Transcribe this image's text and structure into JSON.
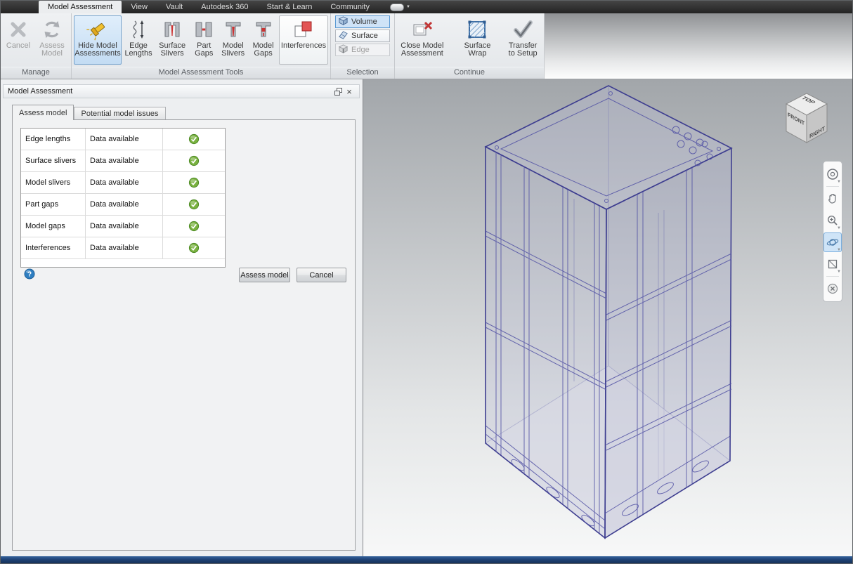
{
  "menubar": {
    "tabs": [
      "Model Assessment",
      "View",
      "Vault",
      "Autodesk 360",
      "Start & Learn",
      "Community"
    ]
  },
  "glyphs": {
    "caret": "▼",
    "close": "×",
    "help": "?"
  },
  "ribbon": {
    "groups": {
      "manage": {
        "label": "Manage",
        "cancel": "Cancel",
        "assess_model": "Assess Model"
      },
      "tools": {
        "label": "Model Assessment Tools",
        "hide_model_assessments": "Hide Model Assessments",
        "edge_lengths": "Edge Lengths",
        "surface_slivers": "Surface Slivers",
        "part_gaps": "Part Gaps",
        "model_slivers": "Model Slivers",
        "model_gaps": "Model Gaps",
        "interferences": "Interferences"
      },
      "selection": {
        "label": "Selection",
        "volume": "Volume",
        "surface": "Surface",
        "edge": "Edge"
      },
      "continue": {
        "label": "Continue",
        "close_model_assessment": "Close Model Assessment",
        "surface_wrap": "Surface Wrap",
        "transfer_to_setup": "Transfer to Setup"
      }
    }
  },
  "panel": {
    "title": "Model Assessment",
    "tabs": [
      "Assess model",
      "Potential model issues"
    ],
    "rows": [
      {
        "name": "Edge lengths",
        "status": "Data available"
      },
      {
        "name": "Surface slivers",
        "status": "Data available"
      },
      {
        "name": "Model slivers",
        "status": "Data available"
      },
      {
        "name": "Part gaps",
        "status": "Data available"
      },
      {
        "name": "Model gaps",
        "status": "Data available"
      },
      {
        "name": "Interferences",
        "status": "Data available"
      }
    ],
    "assess_button": "Assess model",
    "cancel_button": "Cancel"
  },
  "viewport": {
    "viewcube": {
      "top": "TOP",
      "front": "FRONT",
      "right": "RIGHT"
    }
  },
  "colors": {
    "selection_highlight": "#cfe3f7",
    "accent_border": "#5d9bd3",
    "check_green": "#79b13f",
    "error_red": "#cc3333",
    "statusbar_blue": "#1e4174"
  }
}
